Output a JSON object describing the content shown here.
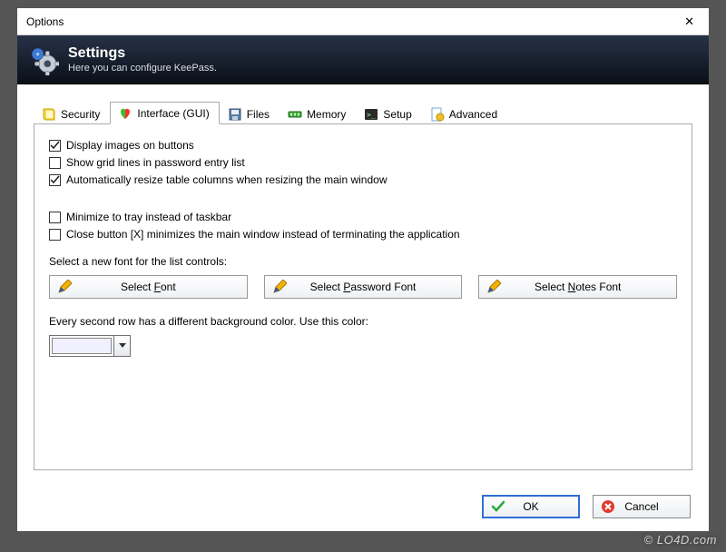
{
  "window": {
    "title": "Options"
  },
  "banner": {
    "title": "Settings",
    "subtitle": "Here you can configure KeePass."
  },
  "tabs": {
    "security": "Security",
    "interface": "Interface (GUI)",
    "files": "Files",
    "memory": "Memory",
    "setup": "Setup",
    "advanced": "Advanced"
  },
  "options": {
    "display_images": {
      "label": "Display images on buttons",
      "checked": true
    },
    "grid_lines": {
      "label": "Show grid lines in password entry list",
      "checked": false
    },
    "auto_resize": {
      "label": "Automatically resize table columns when resizing the main window",
      "checked": true
    },
    "min_tray": {
      "label": "Minimize to tray instead of taskbar",
      "checked": false
    },
    "close_min": {
      "label": "Close button [X] minimizes the main window instead of terminating the application",
      "checked": false
    }
  },
  "font_section": {
    "label": "Select a new font for the list controls:",
    "select_font": "Select Font",
    "select_pw_font": "Select Password Font",
    "select_notes_font": "Select Notes Font"
  },
  "color_section": {
    "label": "Every second row has a different background color. Use this color:",
    "swatch": "#f0f0ff"
  },
  "buttons": {
    "ok": "OK",
    "cancel": "Cancel"
  },
  "watermark": "© LO4D.com"
}
